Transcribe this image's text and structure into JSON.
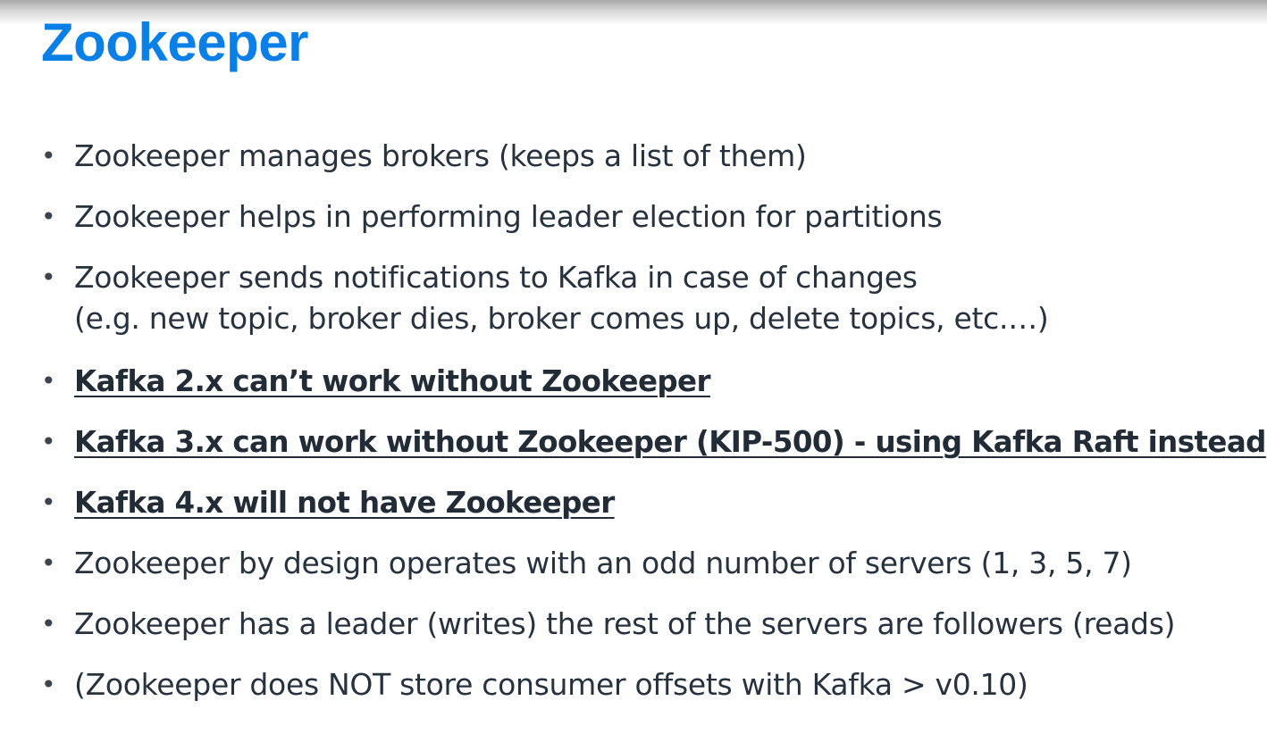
{
  "title": "Zookeeper",
  "bullets": [
    {
      "text": "Zookeeper manages brokers (keeps a list of them)",
      "emphasis": false
    },
    {
      "text": "Zookeeper helps in performing leader election for partitions",
      "emphasis": false
    },
    {
      "text": "Zookeeper sends notifications to Kafka in case of changes",
      "text2": "(e.g. new topic, broker dies, broker comes up, delete topics, etc.…)",
      "emphasis": false
    },
    {
      "text": "Kafka 2.x can’t work without Zookeeper",
      "emphasis": true
    },
    {
      "text": "Kafka 3.x can work without Zookeeper (KIP-500) - using Kafka Raft instead",
      "emphasis": true
    },
    {
      "text": "Kafka 4.x will not have Zookeeper",
      "emphasis": true
    },
    {
      "text": "Zookeeper by design operates with an odd number of servers (1, 3, 5, 7)",
      "emphasis": false
    },
    {
      "text": "Zookeeper has a leader (writes) the rest of the servers are followers (reads)",
      "emphasis": false
    },
    {
      "text": "(Zookeeper does NOT store consumer offsets with Kafka > v0.10)",
      "emphasis": false
    }
  ]
}
